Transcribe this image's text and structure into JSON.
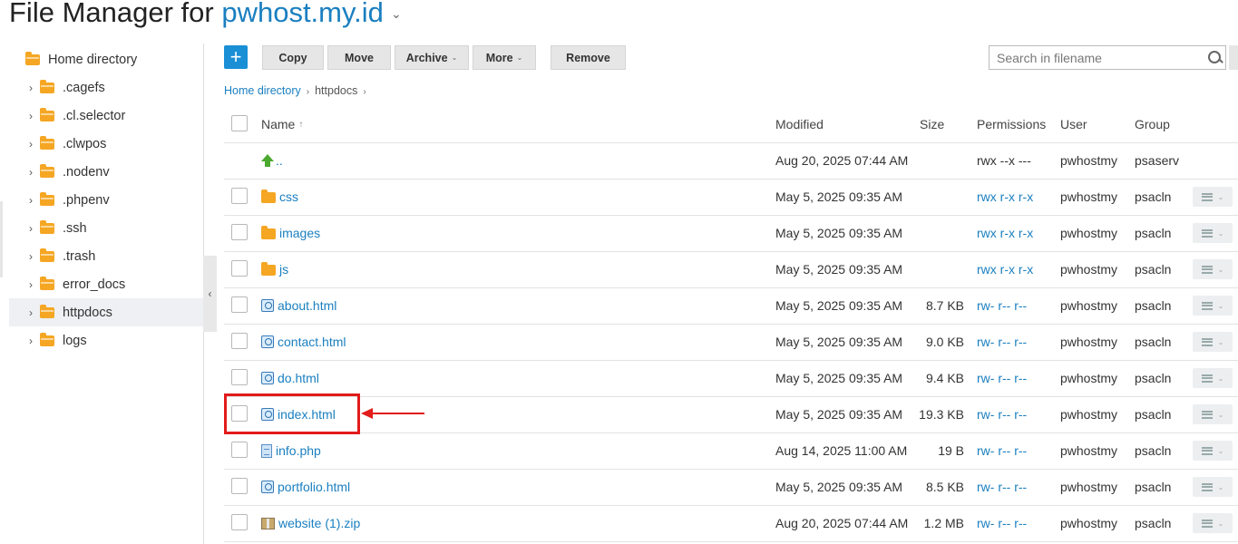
{
  "title": {
    "prefix": "File Manager for ",
    "domain": "pwhost.my.id"
  },
  "sidebar": {
    "items": [
      {
        "label": "Home directory",
        "active": false,
        "expandable": false
      },
      {
        "label": ".cagefs",
        "active": false,
        "expandable": true
      },
      {
        "label": ".cl.selector",
        "active": false,
        "expandable": true
      },
      {
        "label": ".clwpos",
        "active": false,
        "expandable": true
      },
      {
        "label": ".nodenv",
        "active": false,
        "expandable": true
      },
      {
        "label": ".phpenv",
        "active": false,
        "expandable": true
      },
      {
        "label": ".ssh",
        "active": false,
        "expandable": true
      },
      {
        "label": ".trash",
        "active": false,
        "expandable": true
      },
      {
        "label": "error_docs",
        "active": false,
        "expandable": true
      },
      {
        "label": "httpdocs",
        "active": true,
        "expandable": true
      },
      {
        "label": "logs",
        "active": false,
        "expandable": true
      }
    ]
  },
  "toolbar": {
    "copy": "Copy",
    "move": "Move",
    "archive": "Archive",
    "more": "More",
    "remove": "Remove",
    "search_placeholder": "Search in filename"
  },
  "breadcrumb": {
    "home": "Home directory",
    "current": "httpdocs"
  },
  "table": {
    "headers": {
      "name": "Name",
      "sort_indicator": "↑",
      "modified": "Modified",
      "size": "Size",
      "permissions": "Permissions",
      "user": "User",
      "group": "Group"
    },
    "rows": [
      {
        "name": "..",
        "type": "up",
        "modified": "Aug 20, 2025 07:44 AM",
        "size": "",
        "permissions": "rwx --x ---",
        "perm_link": false,
        "user": "pwhostmy",
        "group": "psaserv",
        "checkbox": false,
        "menu": false
      },
      {
        "name": "css",
        "type": "folder",
        "modified": "May 5, 2025 09:35 AM",
        "size": "",
        "permissions": "rwx r-x r-x",
        "perm_link": true,
        "user": "pwhostmy",
        "group": "psacln",
        "checkbox": true,
        "menu": true
      },
      {
        "name": "images",
        "type": "folder",
        "modified": "May 5, 2025 09:35 AM",
        "size": "",
        "permissions": "rwx r-x r-x",
        "perm_link": true,
        "user": "pwhostmy",
        "group": "psacln",
        "checkbox": true,
        "menu": true
      },
      {
        "name": "js",
        "type": "folder",
        "modified": "May 5, 2025 09:35 AM",
        "size": "",
        "permissions": "rwx r-x r-x",
        "perm_link": true,
        "user": "pwhostmy",
        "group": "psacln",
        "checkbox": true,
        "menu": true
      },
      {
        "name": "about.html",
        "type": "html",
        "modified": "May 5, 2025 09:35 AM",
        "size": "8.7 KB",
        "permissions": "rw- r-- r--",
        "perm_link": true,
        "user": "pwhostmy",
        "group": "psacln",
        "checkbox": true,
        "menu": true
      },
      {
        "name": "contact.html",
        "type": "html",
        "modified": "May 5, 2025 09:35 AM",
        "size": "9.0 KB",
        "permissions": "rw- r-- r--",
        "perm_link": true,
        "user": "pwhostmy",
        "group": "psacln",
        "checkbox": true,
        "menu": true
      },
      {
        "name": "do.html",
        "type": "html",
        "modified": "May 5, 2025 09:35 AM",
        "size": "9.4 KB",
        "permissions": "rw- r-- r--",
        "perm_link": true,
        "user": "pwhostmy",
        "group": "psacln",
        "checkbox": true,
        "menu": true
      },
      {
        "name": "index.html",
        "type": "html",
        "modified": "May 5, 2025 09:35 AM",
        "size": "19.3 KB",
        "permissions": "rw- r-- r--",
        "perm_link": true,
        "user": "pwhostmy",
        "group": "psacln",
        "checkbox": true,
        "menu": true
      },
      {
        "name": "info.php",
        "type": "php",
        "modified": "Aug 14, 2025 11:00 AM",
        "size": "19 B",
        "permissions": "rw- r-- r--",
        "perm_link": true,
        "user": "pwhostmy",
        "group": "psacln",
        "checkbox": true,
        "menu": true
      },
      {
        "name": "portfolio.html",
        "type": "html",
        "modified": "May 5, 2025 09:35 AM",
        "size": "8.5 KB",
        "permissions": "rw- r-- r--",
        "perm_link": true,
        "user": "pwhostmy",
        "group": "psacln",
        "checkbox": true,
        "menu": true
      },
      {
        "name": "website (1).zip",
        "type": "zip",
        "modified": "Aug 20, 2025 07:44 AM",
        "size": "1.2 MB",
        "permissions": "rw- r-- r--",
        "perm_link": true,
        "user": "pwhostmy",
        "group": "psacln",
        "checkbox": true,
        "menu": true
      }
    ]
  },
  "colors": {
    "accent": "#1a7fc0",
    "primary_button": "#1a8fd6",
    "highlight": "#e21b1b",
    "folder": "#f5a623"
  }
}
